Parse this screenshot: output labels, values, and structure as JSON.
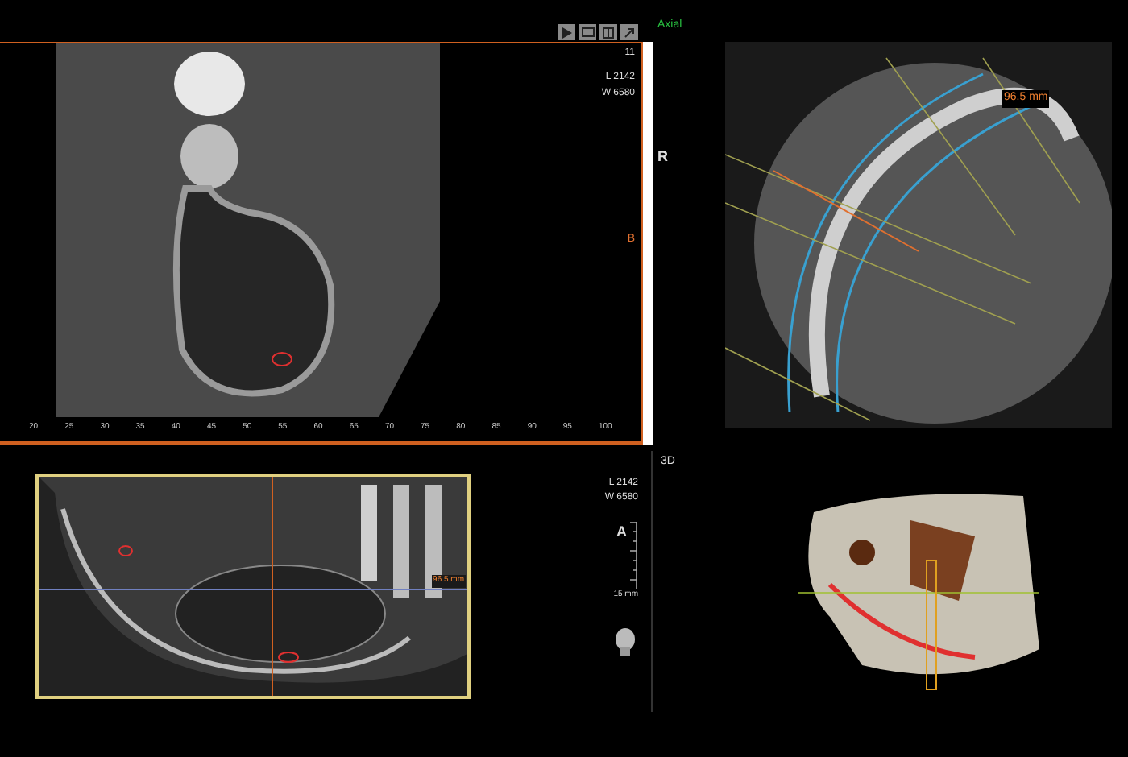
{
  "toolbar": {
    "buttons": [
      {
        "kind": "play"
      },
      {
        "kind": "window"
      },
      {
        "kind": "layout"
      },
      {
        "kind": "expand"
      }
    ]
  },
  "sagittal": {
    "index": "11",
    "level": "L 2142",
    "width": "W 6580",
    "side_top": "R",
    "side_mid": "B",
    "ruler": [
      "20",
      "25",
      "30",
      "35",
      "40",
      "45",
      "50",
      "55",
      "60",
      "65",
      "70",
      "75",
      "80",
      "85",
      "90",
      "95",
      "100"
    ]
  },
  "axial": {
    "title": "Axial",
    "measure": "96.5 mm"
  },
  "panoramic": {
    "level": "L 2142",
    "width": "W 6580",
    "side": "A",
    "scale": "15 mm",
    "measure": "96.5 mm"
  },
  "volume": {
    "title": "3D"
  }
}
